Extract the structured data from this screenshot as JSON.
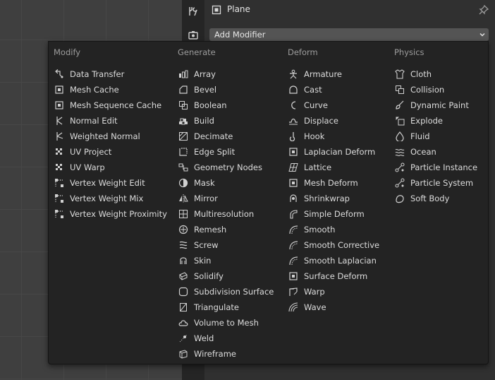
{
  "header": {
    "object_name": "Plane"
  },
  "add_modifier": {
    "label": "Add Modifier"
  },
  "menu": {
    "columns": [
      {
        "title": "Modify",
        "items": [
          {
            "label": "Data Transfer",
            "icon": "data-transfer-icon"
          },
          {
            "label": "Mesh Cache",
            "icon": "mesh-cache-icon"
          },
          {
            "label": "Mesh Sequence Cache",
            "icon": "mesh-sequence-cache-icon"
          },
          {
            "label": "Normal Edit",
            "icon": "normal-edit-icon"
          },
          {
            "label": "Weighted Normal",
            "icon": "weighted-normal-icon"
          },
          {
            "label": "UV Project",
            "icon": "uv-project-icon"
          },
          {
            "label": "UV Warp",
            "icon": "uv-warp-icon"
          },
          {
            "label": "Vertex Weight Edit",
            "icon": "vertex-weight-edit-icon"
          },
          {
            "label": "Vertex Weight Mix",
            "icon": "vertex-weight-mix-icon"
          },
          {
            "label": "Vertex Weight Proximity",
            "icon": "vertex-weight-proximity-icon"
          }
        ]
      },
      {
        "title": "Generate",
        "items": [
          {
            "label": "Array",
            "icon": "array-icon"
          },
          {
            "label": "Bevel",
            "icon": "bevel-icon"
          },
          {
            "label": "Boolean",
            "icon": "boolean-icon"
          },
          {
            "label": "Build",
            "icon": "build-icon"
          },
          {
            "label": "Decimate",
            "icon": "decimate-icon"
          },
          {
            "label": "Edge Split",
            "icon": "edge-split-icon"
          },
          {
            "label": "Geometry Nodes",
            "icon": "geometry-nodes-icon"
          },
          {
            "label": "Mask",
            "icon": "mask-icon"
          },
          {
            "label": "Mirror",
            "icon": "mirror-icon"
          },
          {
            "label": "Multiresolution",
            "icon": "multiresolution-icon"
          },
          {
            "label": "Remesh",
            "icon": "remesh-icon"
          },
          {
            "label": "Screw",
            "icon": "screw-icon"
          },
          {
            "label": "Skin",
            "icon": "skin-icon"
          },
          {
            "label": "Solidify",
            "icon": "solidify-icon"
          },
          {
            "label": "Subdivision Surface",
            "icon": "subdivision-surface-icon"
          },
          {
            "label": "Triangulate",
            "icon": "triangulate-icon"
          },
          {
            "label": "Volume to Mesh",
            "icon": "volume-to-mesh-icon"
          },
          {
            "label": "Weld",
            "icon": "weld-icon"
          },
          {
            "label": "Wireframe",
            "icon": "wireframe-icon"
          }
        ]
      },
      {
        "title": "Deform",
        "items": [
          {
            "label": "Armature",
            "icon": "armature-icon"
          },
          {
            "label": "Cast",
            "icon": "cast-icon"
          },
          {
            "label": "Curve",
            "icon": "curve-icon"
          },
          {
            "label": "Displace",
            "icon": "displace-icon"
          },
          {
            "label": "Hook",
            "icon": "hook-icon"
          },
          {
            "label": "Laplacian Deform",
            "icon": "laplacian-deform-icon"
          },
          {
            "label": "Lattice",
            "icon": "lattice-icon"
          },
          {
            "label": "Mesh Deform",
            "icon": "mesh-deform-icon"
          },
          {
            "label": "Shrinkwrap",
            "icon": "shrinkwrap-icon"
          },
          {
            "label": "Simple Deform",
            "icon": "simple-deform-icon"
          },
          {
            "label": "Smooth",
            "icon": "smooth-icon"
          },
          {
            "label": "Smooth Corrective",
            "icon": "smooth-corrective-icon"
          },
          {
            "label": "Smooth Laplacian",
            "icon": "smooth-laplacian-icon"
          },
          {
            "label": "Surface Deform",
            "icon": "surface-deform-icon"
          },
          {
            "label": "Warp",
            "icon": "warp-icon"
          },
          {
            "label": "Wave",
            "icon": "wave-icon"
          }
        ]
      },
      {
        "title": "Physics",
        "items": [
          {
            "label": "Cloth",
            "icon": "cloth-icon"
          },
          {
            "label": "Collision",
            "icon": "collision-icon"
          },
          {
            "label": "Dynamic Paint",
            "icon": "dynamic-paint-icon"
          },
          {
            "label": "Explode",
            "icon": "explode-icon"
          },
          {
            "label": "Fluid",
            "icon": "fluid-icon"
          },
          {
            "label": "Ocean",
            "icon": "ocean-icon"
          },
          {
            "label": "Particle Instance",
            "icon": "particle-instance-icon"
          },
          {
            "label": "Particle System",
            "icon": "particle-system-icon"
          },
          {
            "label": "Soft Body",
            "icon": "soft-body-icon"
          }
        ]
      }
    ]
  },
  "colors": {
    "menu_bg": "#232323",
    "text": "#dcdcdc",
    "heading": "#9c9c9c",
    "button_bg": "#545454"
  }
}
